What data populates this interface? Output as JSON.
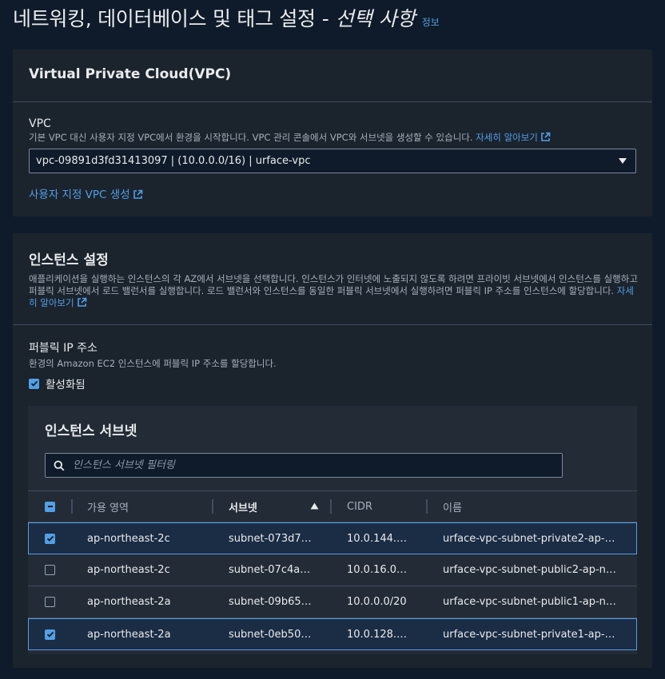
{
  "header": {
    "title": "네트워킹, 데이터베이스 및 태그 설정",
    "separator": "-",
    "optional": "선택 사항",
    "info": "정보"
  },
  "vpc_panel": {
    "title": "Virtual Private Cloud(VPC)",
    "field_label": "VPC",
    "description": "기본 VPC 대신 사용자 지정 VPC에서 환경을 시작합니다. VPC 관리 콘솔에서 VPC와 서브넷을 생성할 수 있습니다.",
    "learn_more": "자세히 알아보기",
    "selected_vpc": "vpc-09891d3fd31413097 | (10.0.0.0/16) | urface-vpc",
    "create_link": "사용자 지정 VPC 생성"
  },
  "instance_panel": {
    "title": "인스턴스 설정",
    "description": "애플리케이션을 실행하는 인스턴스의 각 AZ에서 서브넷을 선택합니다. 인스턴스가 인터넷에 노출되지 않도록 하려면 프라이빗 서브넷에서 인스턴스를 실행하고 퍼블릭 서브넷에서 로드 밸런서를 실행합니다. 로드 밸런서와 인스턴스를 동일한 퍼블릭 서브넷에서 실행하려면 퍼블릭 IP 주소를 인스턴스에 할당합니다.",
    "learn_more": "자세히 알아보기",
    "public_ip_label": "퍼블릭 IP 주소",
    "public_ip_desc": "환경의 Amazon EC2 인스턴스에 퍼블릭 IP 주소를 할당합니다.",
    "public_ip_checkbox": "활성화됨"
  },
  "subnet_table": {
    "title": "인스턴스 서브넷",
    "search_placeholder": "인스턴스 서브넷 필터링",
    "columns": {
      "az": "가용 영역",
      "subnet": "서브넷",
      "cidr": "CIDR",
      "name": "이름"
    },
    "sort_indicator": "ascending",
    "rows": [
      {
        "selected": true,
        "az": "ap-northeast-2c",
        "subnet": "subnet-073d7…",
        "cidr": "10.0.144.…",
        "name": "urface-vpc-subnet-private2-ap-…"
      },
      {
        "selected": false,
        "az": "ap-northeast-2c",
        "subnet": "subnet-07c4a…",
        "cidr": "10.0.16.0…",
        "name": "urface-vpc-subnet-public2-ap-n…"
      },
      {
        "selected": false,
        "az": "ap-northeast-2a",
        "subnet": "subnet-09b65…",
        "cidr": "10.0.0.0/20",
        "name": "urface-vpc-subnet-public1-ap-n…"
      },
      {
        "selected": true,
        "az": "ap-northeast-2a",
        "subnet": "subnet-0eb50…",
        "cidr": "10.0.128.…",
        "name": "urface-vpc-subnet-private1-ap-…"
      }
    ]
  },
  "colors": {
    "background": "#0f1b2a",
    "panel": "#1b232d",
    "accent": "#539fe5",
    "selected_row": "#1b2c45"
  }
}
